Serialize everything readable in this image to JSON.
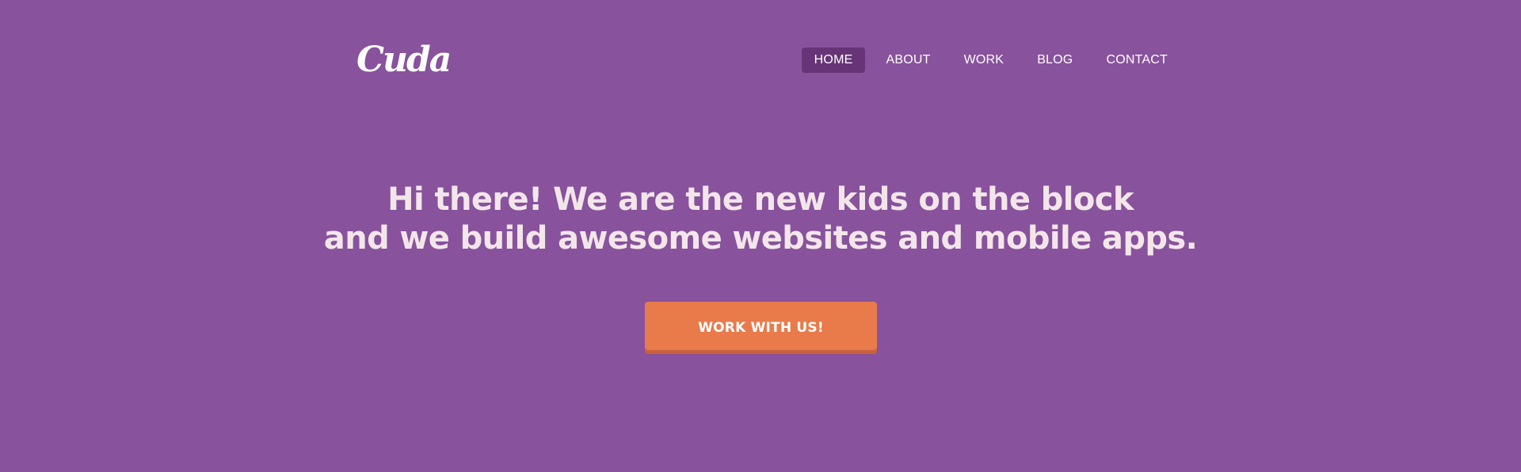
{
  "brand": {
    "logo_text": "Cuda"
  },
  "nav": {
    "items": [
      {
        "label": "HOME",
        "active": true
      },
      {
        "label": "ABOUT",
        "active": false
      },
      {
        "label": "WORK",
        "active": false
      },
      {
        "label": "BLOG",
        "active": false
      },
      {
        "label": "CONTACT",
        "active": false
      }
    ]
  },
  "hero": {
    "title_line_1": "Hi there! We are the new kids on the block",
    "title_line_2": "and we build awesome websites and mobile apps.",
    "cta_label": "WORK WITH US!"
  },
  "colors": {
    "background": "#88529c",
    "nav_active_bg": "#673577",
    "cta_bg": "#e97b4b",
    "cta_shadow": "#c8603c",
    "hero_text": "#f3e6ea"
  }
}
